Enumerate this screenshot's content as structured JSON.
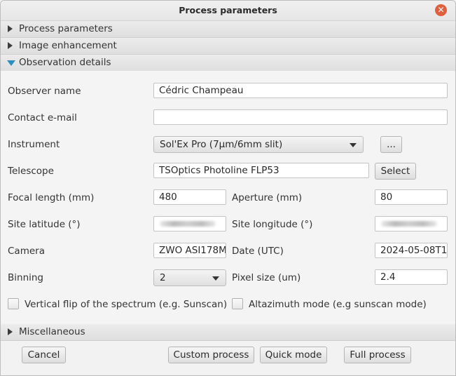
{
  "window": {
    "title": "Process parameters"
  },
  "sections": {
    "process_parameters": "Process parameters",
    "image_enhancement": "Image enhancement",
    "observation_details": "Observation details",
    "miscellaneous": "Miscellaneous"
  },
  "observation": {
    "observer_name": {
      "label": "Observer name",
      "value": "Cédric Champeau"
    },
    "contact_email": {
      "label": "Contact e-mail",
      "value": ""
    },
    "instrument": {
      "label": "Instrument",
      "value": "Sol'Ex Pro (7µm/6mm slit)",
      "more_label": "..."
    },
    "telescope": {
      "label": "Telescope",
      "value": "TSOptics Photoline FLP53",
      "select_label": "Select"
    },
    "focal_length": {
      "label": "Focal length (mm)",
      "value": "480"
    },
    "aperture": {
      "label": "Aperture (mm)",
      "value": "80"
    },
    "site_latitude": {
      "label": "Site latitude (°)"
    },
    "site_longitude": {
      "label": "Site longitude (°)"
    },
    "camera": {
      "label": "Camera",
      "value": "ZWO ASI178M"
    },
    "date": {
      "label": "Date (UTC)",
      "value": "2024-05-08T1"
    },
    "binning": {
      "label": "Binning",
      "value": "2"
    },
    "pixel_size": {
      "label": "Pixel size (um)",
      "value": "2.4"
    },
    "vertical_flip": {
      "label": "Vertical flip of the spectrum (e.g. Sunscan)",
      "checked": false
    },
    "altazimuth": {
      "label": "Altazimuth mode (e.g sunscan mode)",
      "checked": false
    }
  },
  "footer": {
    "cancel": "Cancel",
    "custom_process": "Custom process",
    "quick_mode": "Quick mode",
    "full_process": "Full process"
  },
  "colors": {
    "close_button": "#e0603e",
    "expanded_arrow": "#2e8fbf"
  }
}
